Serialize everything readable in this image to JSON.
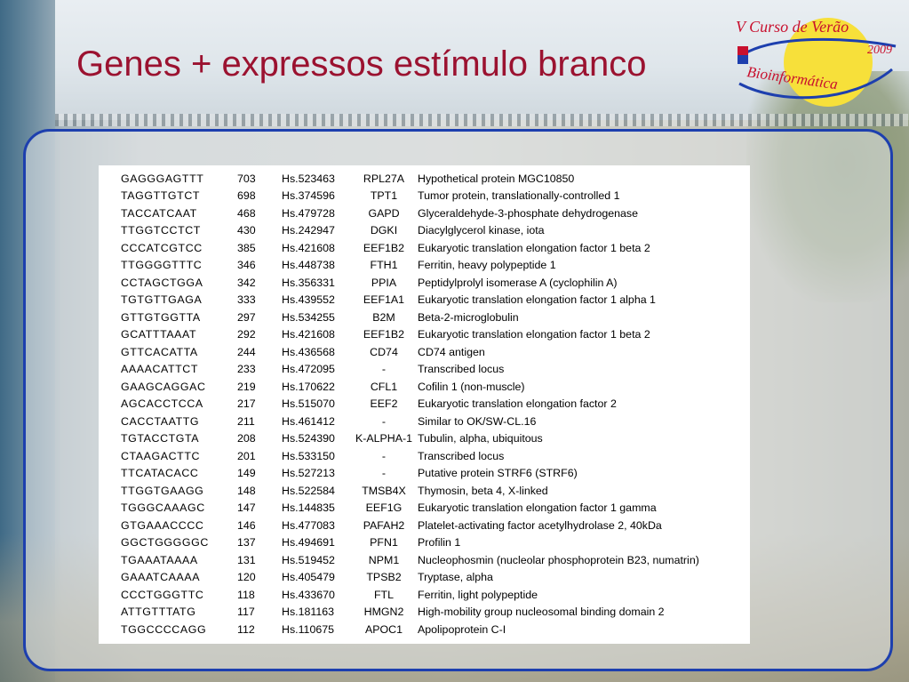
{
  "slide": {
    "title": "Genes + expressos estímulo branco"
  },
  "logo": {
    "line1": "V Curso de Verão",
    "year": "2009",
    "subtitle": "Bioinformática",
    "colors": {
      "sun": "#f7e03a",
      "red": "#c8102e",
      "blue": "#1d3fae"
    }
  },
  "table": {
    "rows": [
      {
        "tag": "GAGGGAGTTT",
        "count": "703",
        "unigene": "Hs.523463",
        "symbol": "RPL27A",
        "description": "Hypothetical protein MGC10850"
      },
      {
        "tag": "TAGGTTGTCT",
        "count": "698",
        "unigene": "Hs.374596",
        "symbol": "TPT1",
        "description": "Tumor protein, translationally-controlled 1"
      },
      {
        "tag": "TACCATCAAT",
        "count": "468",
        "unigene": "Hs.479728",
        "symbol": "GAPD",
        "description": "Glyceraldehyde-3-phosphate dehydrogenase"
      },
      {
        "tag": "TTGGTCCTCT",
        "count": "430",
        "unigene": "Hs.242947",
        "symbol": "DGKI",
        "description": "Diacylglycerol kinase, iota"
      },
      {
        "tag": "CCCATCGTCC",
        "count": "385",
        "unigene": "Hs.421608",
        "symbol": "EEF1B2",
        "description": "Eukaryotic translation elongation factor 1 beta 2"
      },
      {
        "tag": "TTGGGGTTTC",
        "count": "346",
        "unigene": "Hs.448738",
        "symbol": "FTH1",
        "description": "Ferritin, heavy polypeptide 1"
      },
      {
        "tag": "CCTAGCTGGA",
        "count": "342",
        "unigene": "Hs.356331",
        "symbol": "PPIA",
        "description": "Peptidylprolyl isomerase A (cyclophilin A)"
      },
      {
        "tag": "TGTGTTGAGA",
        "count": "333",
        "unigene": "Hs.439552",
        "symbol": "EEF1A1",
        "description": "Eukaryotic translation elongation factor 1 alpha 1"
      },
      {
        "tag": "GTTGTGGTTA",
        "count": "297",
        "unigene": "Hs.534255",
        "symbol": "B2M",
        "description": "Beta-2-microglobulin"
      },
      {
        "tag": "GCATTTAAAT",
        "count": "292",
        "unigene": "Hs.421608",
        "symbol": "EEF1B2",
        "description": "Eukaryotic translation elongation factor 1 beta 2"
      },
      {
        "tag": "GTTCACATTA",
        "count": "244",
        "unigene": "Hs.436568",
        "symbol": "CD74",
        "description": "CD74 antigen"
      },
      {
        "tag": "AAAACATTCT",
        "count": "233",
        "unigene": "Hs.472095",
        "symbol": "-",
        "description": "Transcribed locus"
      },
      {
        "tag": "GAAGCAGGAC",
        "count": "219",
        "unigene": "Hs.170622",
        "symbol": "CFL1",
        "description": "Cofilin 1 (non-muscle)"
      },
      {
        "tag": "AGCACCTCCA",
        "count": "217",
        "unigene": "Hs.515070",
        "symbol": "EEF2",
        "description": "Eukaryotic translation elongation factor 2"
      },
      {
        "tag": "CACCTAATTG",
        "count": "211",
        "unigene": "Hs.461412",
        "symbol": "-",
        "description": "Similar to OK/SW-CL.16"
      },
      {
        "tag": "TGTACCTGTA",
        "count": "208",
        "unigene": "Hs.524390",
        "symbol": "K-ALPHA-1",
        "description": "Tubulin, alpha, ubiquitous"
      },
      {
        "tag": "CTAAGACTTC",
        "count": "201",
        "unigene": "Hs.533150",
        "symbol": "-",
        "description": "Transcribed locus"
      },
      {
        "tag": "TTCATACACC",
        "count": "149",
        "unigene": "Hs.527213",
        "symbol": "-",
        "description": "Putative protein STRF6 (STRF6)"
      },
      {
        "tag": "TTGGTGAAGG",
        "count": "148",
        "unigene": "Hs.522584",
        "symbol": "TMSB4X",
        "description": "Thymosin, beta 4, X-linked"
      },
      {
        "tag": "TGGGCAAAGC",
        "count": "147",
        "unigene": "Hs.144835",
        "symbol": "EEF1G",
        "description": "Eukaryotic translation elongation factor 1 gamma"
      },
      {
        "tag": "GTGAAACCCC",
        "count": "146",
        "unigene": "Hs.477083",
        "symbol": "PAFAH2",
        "description": "Platelet-activating factor acetylhydrolase 2, 40kDa"
      },
      {
        "tag": "GGCTGGGGGC",
        "count": "137",
        "unigene": "Hs.494691",
        "symbol": "PFN1",
        "description": "Profilin 1"
      },
      {
        "tag": "TGAAATAAAA",
        "count": "131",
        "unigene": "Hs.519452",
        "symbol": "NPM1",
        "description": "Nucleophosmin (nucleolar phosphoprotein B23, numatrin)"
      },
      {
        "tag": "GAAATCAAAA",
        "count": "120",
        "unigene": "Hs.405479",
        "symbol": "TPSB2",
        "description": "Tryptase, alpha"
      },
      {
        "tag": "CCCTGGGTTC",
        "count": "118",
        "unigene": "Hs.433670",
        "symbol": "FTL",
        "description": "Ferritin, light polypeptide"
      },
      {
        "tag": "ATTGTTTATG",
        "count": "117",
        "unigene": "Hs.181163",
        "symbol": "HMGN2",
        "description": "High-mobility group nucleosomal binding domain 2"
      },
      {
        "tag": "TGGCCCCAGG",
        "count": "112",
        "unigene": "Hs.110675",
        "symbol": "APOC1",
        "description": "Apolipoprotein C-I"
      }
    ]
  }
}
